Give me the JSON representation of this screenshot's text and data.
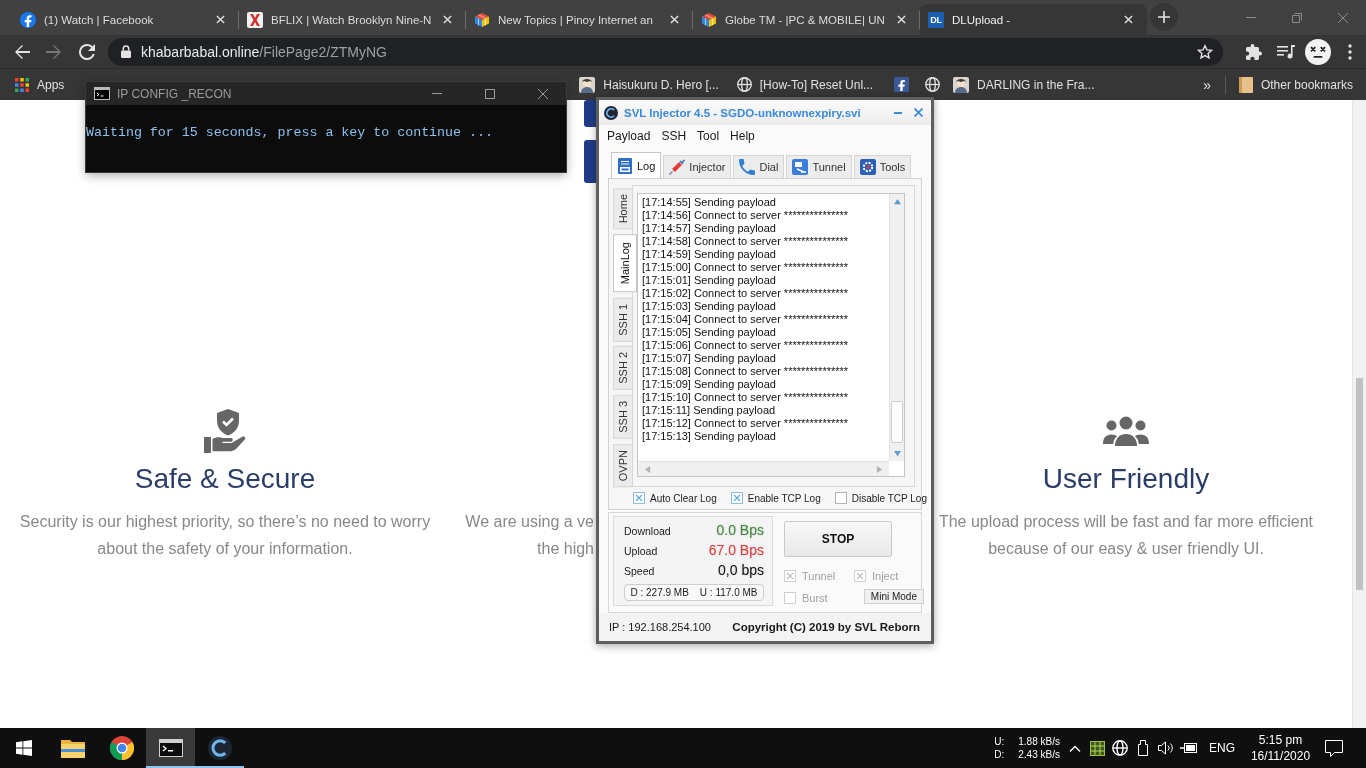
{
  "browser": {
    "tabs": [
      {
        "kind": "facebook",
        "title": "(1) Watch | Facebook",
        "selected": false
      },
      {
        "kind": "cross",
        "title": "BFLIX | Watch Brooklyn Nine-N",
        "selected": false
      },
      {
        "kind": "cube",
        "title": "New Topics | Pinoy Internet an",
        "selected": false
      },
      {
        "kind": "cube",
        "title": "Globe TM - |PC & MOBILE| UN",
        "selected": false
      },
      {
        "kind": "letters",
        "favicon_text": "DL",
        "title": "DLUpload -",
        "selected": true
      }
    ],
    "address": {
      "host": "khabarbabal.online",
      "path": "/FilePage2/ZTMyNG"
    },
    "bookmarks": [
      {
        "kind": "apps",
        "label": "Apps"
      },
      {
        "kind": "picture",
        "label": "Haisukuru D. Hero [..."
      },
      {
        "kind": "globe",
        "label": "[How-To] Reset Unl..."
      },
      {
        "kind": "facebook"
      },
      {
        "kind": "globe"
      },
      {
        "kind": "picture",
        "label": "DARLING in the Fra..."
      }
    ],
    "more_bookmarks": "»",
    "other_bookmarks": "Other bookmarks"
  },
  "page": {
    "features": [
      {
        "kind": "shield-hand",
        "title": "Safe & Secure",
        "text": "Security is our highest priority, so there’s no need to worry\nabout the safety of your information."
      },
      {
        "kind": "covered",
        "text": "We are using a ve\nthe high"
      },
      {
        "kind": "users",
        "title": "User Friendly",
        "text": "The upload process will be fast and far more efficient\nbecause of our easy & user friendly UI."
      }
    ]
  },
  "console": {
    "title": "IP CONFIG _RECON",
    "output": "Waiting for 15 seconds, press a key to continue ..."
  },
  "injector": {
    "title": "SVL Injector 4.5 - SGDO-unknownexpiry.svi",
    "menu": [
      "Payload",
      "SSH",
      "Tool",
      "Help"
    ],
    "tabs": [
      {
        "kind": "log",
        "label": "Log",
        "selected": true
      },
      {
        "kind": "syringe",
        "label": "Injector",
        "selected": false
      },
      {
        "kind": "phone",
        "label": "Dial",
        "selected": false
      },
      {
        "kind": "tunnel",
        "label": "Tunnel",
        "selected": false
      },
      {
        "kind": "tools",
        "label": "Tools",
        "selected": false
      }
    ],
    "side_tabs": [
      {
        "label": "Home",
        "selected": false
      },
      {
        "label": "MainLog",
        "selected": true
      },
      {
        "label": "SSH 1",
        "selected": false
      },
      {
        "label": "SSH 2",
        "selected": false
      },
      {
        "label": "SSH 3",
        "selected": false
      },
      {
        "label": "OVPN",
        "selected": false
      }
    ],
    "log": [
      "[17:14:55] Sending payload",
      "[17:14:56] Connect to server ***************",
      "[17:14:57] Sending payload",
      "[17:14:58] Connect to server ***************",
      "[17:14:59] Sending payload",
      "[17:15:00] Connect to server ***************",
      "[17:15:01] Sending payload",
      "[17:15:02] Connect to server ***************",
      "[17:15:03] Sending payload",
      "[17:15:04] Connect to server ***************",
      "[17:15:05] Sending payload",
      "[17:15:06] Connect to server ***************",
      "[17:15:07] Sending payload",
      "[17:15:08] Connect to server ***************",
      "[17:15:09] Sending payload",
      "[17:15:10] Connect to server ***************",
      "[17:15:11] Sending payload",
      "[17:15:12] Connect to server ***************",
      "[17:15:13] Sending payload"
    ],
    "log_options": [
      {
        "label": "Auto Clear Log",
        "checked": true
      },
      {
        "label": "Enable TCP Log",
        "checked": true
      },
      {
        "label": "Disable TCP Log",
        "checked": false
      }
    ],
    "stats": [
      {
        "label": "Download",
        "value": "0.0 Bps",
        "color": "#3f8a3a"
      },
      {
        "label": "Upload",
        "value": "67.0 Bps",
        "color": "#e23b3b"
      },
      {
        "label": "Speed",
        "value": "0,0 bps",
        "color": "#111111"
      }
    ],
    "totals": [
      "D : 227.9 MB",
      "U : 117.0 MB"
    ],
    "stop_button": "STOP",
    "options": [
      {
        "label": "Tunnel",
        "checked": true,
        "disabled": true
      },
      {
        "label": "Inject",
        "checked": true,
        "disabled": true
      },
      {
        "label": "Burst",
        "checked": false,
        "disabled": true
      }
    ],
    "mini_mode_button": "Mini Mode",
    "ip": "IP : 192.168.254.100",
    "copyright": "Copyright (C) 2019 by SVL Reborn"
  },
  "taskbar": {
    "apps": [
      {
        "kind": "folder",
        "running": false,
        "active": false
      },
      {
        "kind": "chrome",
        "running": false,
        "active": false
      },
      {
        "kind": "terminal",
        "running": true,
        "active": true
      },
      {
        "kind": "svl",
        "running": true,
        "active": false
      }
    ],
    "network": [
      {
        "label": "U:",
        "rate": "1.88 kB/s"
      },
      {
        "label": "D:",
        "rate": "2.43 kB/s"
      }
    ],
    "language": "ENG",
    "time": "5:15 pm",
    "date": "16/11/2020"
  }
}
